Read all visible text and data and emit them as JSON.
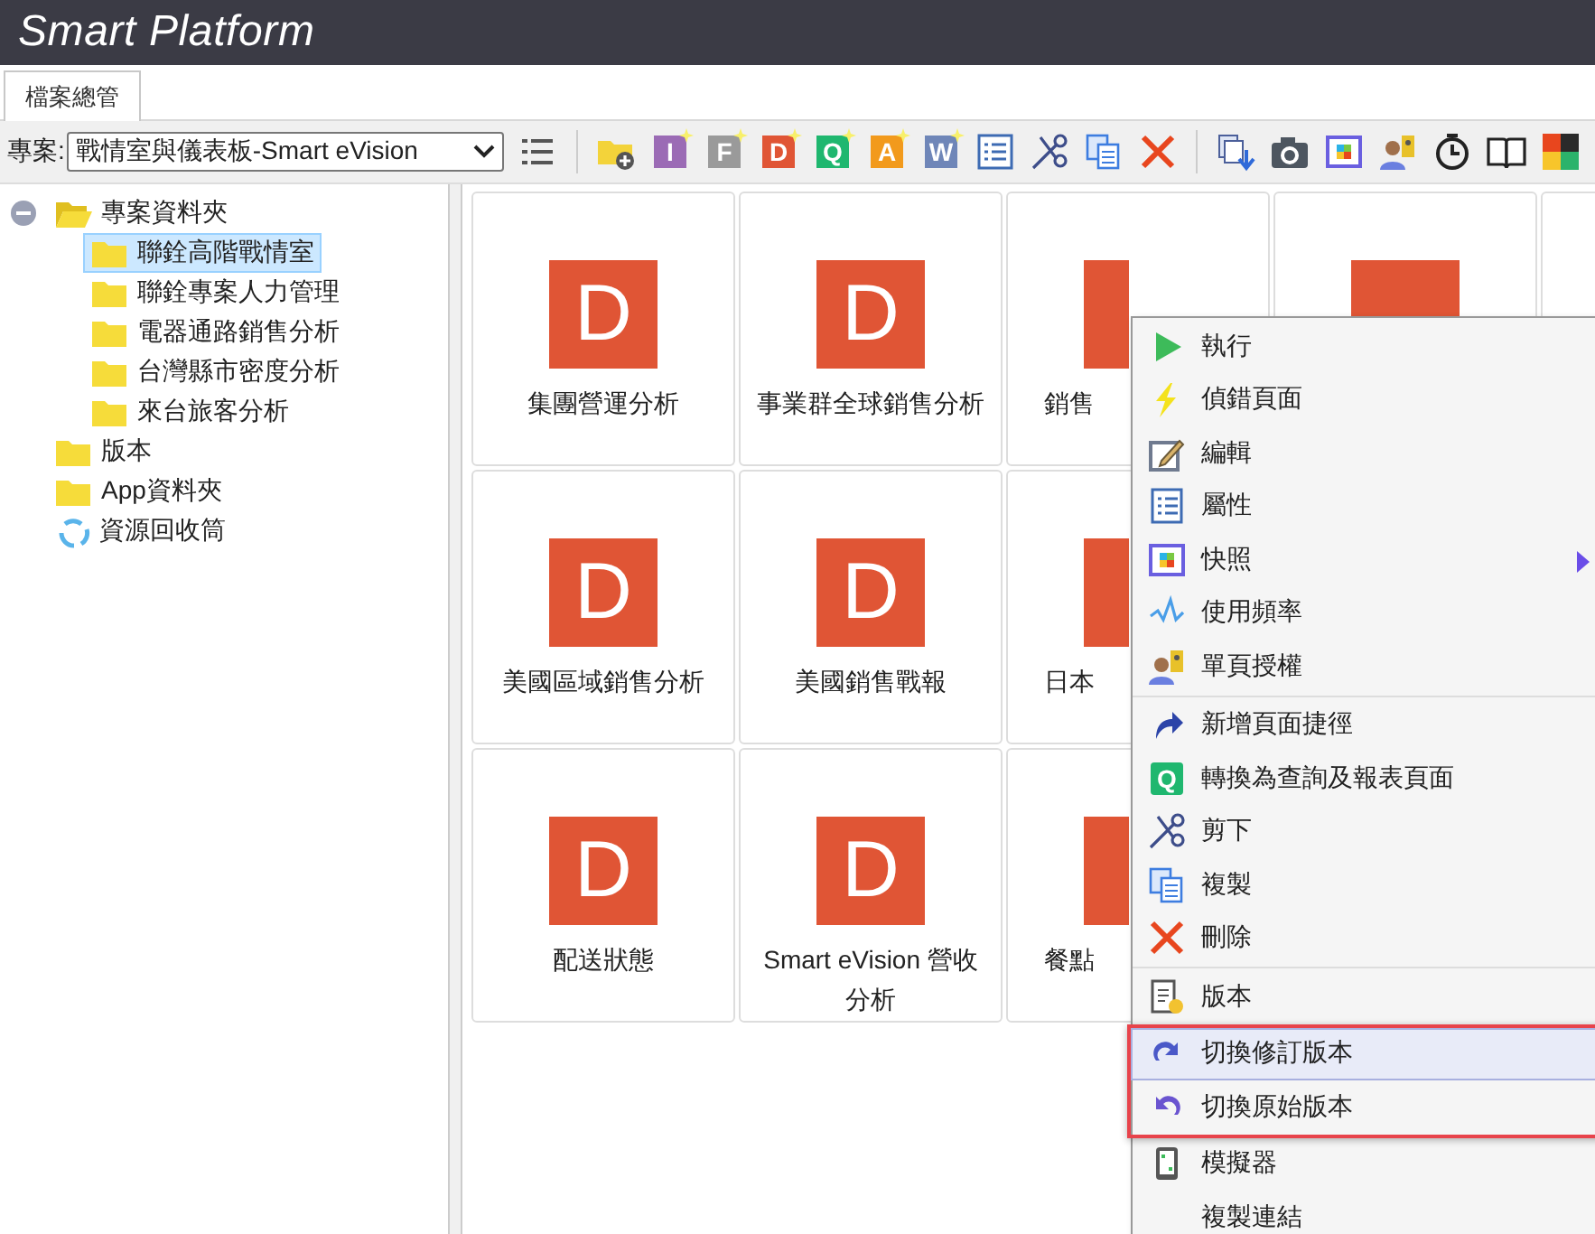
{
  "app": {
    "title": "Smart Platform"
  },
  "tabs": [
    {
      "label": "檔案總管",
      "selected": true
    }
  ],
  "toolbar": {
    "project_label": "專案:",
    "project_value": "戰情室與儀表板-Smart eVision",
    "tools": [
      {
        "kind": "list"
      },
      {
        "kind": "separator"
      },
      {
        "kind": "folder-add"
      },
      {
        "kind": "letter",
        "text": "I",
        "color": "#9b6bb5"
      },
      {
        "kind": "letter",
        "text": "F",
        "color": "#9a9a9a"
      },
      {
        "kind": "letter",
        "text": "D",
        "color": "#e05535"
      },
      {
        "kind": "letter",
        "text": "Q",
        "color": "#1fb76f"
      },
      {
        "kind": "letter",
        "text": "A",
        "color": "#f29a1c"
      },
      {
        "kind": "letter",
        "text": "W",
        "color": "#6f86b8"
      },
      {
        "kind": "properties"
      },
      {
        "kind": "cut"
      },
      {
        "kind": "copy"
      },
      {
        "kind": "delete"
      },
      {
        "kind": "separator"
      },
      {
        "kind": "export"
      },
      {
        "kind": "camera"
      },
      {
        "kind": "snapshot"
      },
      {
        "kind": "user-key"
      },
      {
        "kind": "timer"
      },
      {
        "kind": "book"
      },
      {
        "kind": "app"
      }
    ]
  },
  "tree": [
    {
      "label": "專案資料夾",
      "kind": "folder",
      "expanded": true,
      "selected": false,
      "children": [
        {
          "label": "聯銓高階戰情室",
          "kind": "folder",
          "selected": true
        },
        {
          "label": "聯銓專案人力管理",
          "kind": "folder",
          "selected": false
        },
        {
          "label": "電器通路銷售分析",
          "kind": "folder",
          "selected": false
        },
        {
          "label": "台灣縣市密度分析",
          "kind": "folder",
          "selected": false
        },
        {
          "label": "來台旅客分析",
          "kind": "folder",
          "selected": false
        }
      ]
    },
    {
      "label": "版本",
      "kind": "folder",
      "selected": false
    },
    {
      "label": "App資料夾",
      "kind": "folder",
      "selected": false
    },
    {
      "label": "資源回收筒",
      "kind": "recycle",
      "selected": false
    }
  ],
  "tile_rows": [
    {
      "tiles": [
        {
          "kind": "page",
          "badge": "D",
          "label": "集團營運分析"
        },
        {
          "kind": "page",
          "badge": "D",
          "label": "事業群全球銷售分析"
        },
        {
          "kind": "page",
          "label": "銷售",
          "cut": true
        },
        {
          "kind": "page"
        },
        {
          "kind": "blank"
        }
      ]
    },
    {
      "tiles": [
        {
          "kind": "page",
          "badge": "D",
          "label": "美國區域銷售分析"
        },
        {
          "kind": "page",
          "badge": "D",
          "label": "美國銷售戰報"
        },
        {
          "kind": "page",
          "label": "日本",
          "cut": true
        }
      ]
    },
    {
      "tiles": [
        {
          "kind": "page",
          "badge": "D",
          "label": "配送狀態"
        },
        {
          "kind": "page",
          "badge": "D",
          "label": "Smart eVision 營收分析"
        },
        {
          "kind": "page",
          "label": "餐點",
          "cut": true
        }
      ]
    }
  ],
  "context_menu": [
    {
      "kind": "item",
      "label": "執行",
      "selected": false,
      "highlighted": false
    },
    {
      "kind": "item",
      "label": "偵錯頁面",
      "selected": false,
      "highlighted": false
    },
    {
      "kind": "item",
      "label": "編輯",
      "selected": false,
      "highlighted": false
    },
    {
      "kind": "item",
      "label": "屬性",
      "selected": false,
      "highlighted": false
    },
    {
      "kind": "item",
      "label": "快照",
      "submenu": true,
      "selected": false,
      "highlighted": false
    },
    {
      "kind": "item",
      "label": "使用頻率",
      "selected": false,
      "highlighted": false
    },
    {
      "kind": "item",
      "label": "單頁授權",
      "selected": false,
      "highlighted": false
    },
    {
      "kind": "separator"
    },
    {
      "kind": "item",
      "label": "新增頁面捷徑",
      "selected": false,
      "highlighted": false
    },
    {
      "kind": "item",
      "label": "轉換為查詢及報表頁面",
      "badge": "Q",
      "selected": false,
      "highlighted": false
    },
    {
      "kind": "item",
      "label": "剪下",
      "selected": false,
      "highlighted": false
    },
    {
      "kind": "item",
      "label": "複製",
      "selected": false,
      "highlighted": false
    },
    {
      "kind": "item",
      "label": "刪除",
      "selected": false,
      "highlighted": false
    },
    {
      "kind": "separator"
    },
    {
      "kind": "item",
      "label": "版本",
      "selected": false,
      "highlighted": false
    },
    {
      "kind": "item",
      "label": "切換修訂版本",
      "selected": true,
      "highlighted": true
    },
    {
      "kind": "item",
      "label": "切換原始版本",
      "selected": false,
      "highlighted": true
    },
    {
      "kind": "item",
      "label": "模擬器",
      "selected": false,
      "highlighted": false
    },
    {
      "kind": "item",
      "label": "複製連結",
      "selected": false,
      "highlighted": false
    }
  ]
}
